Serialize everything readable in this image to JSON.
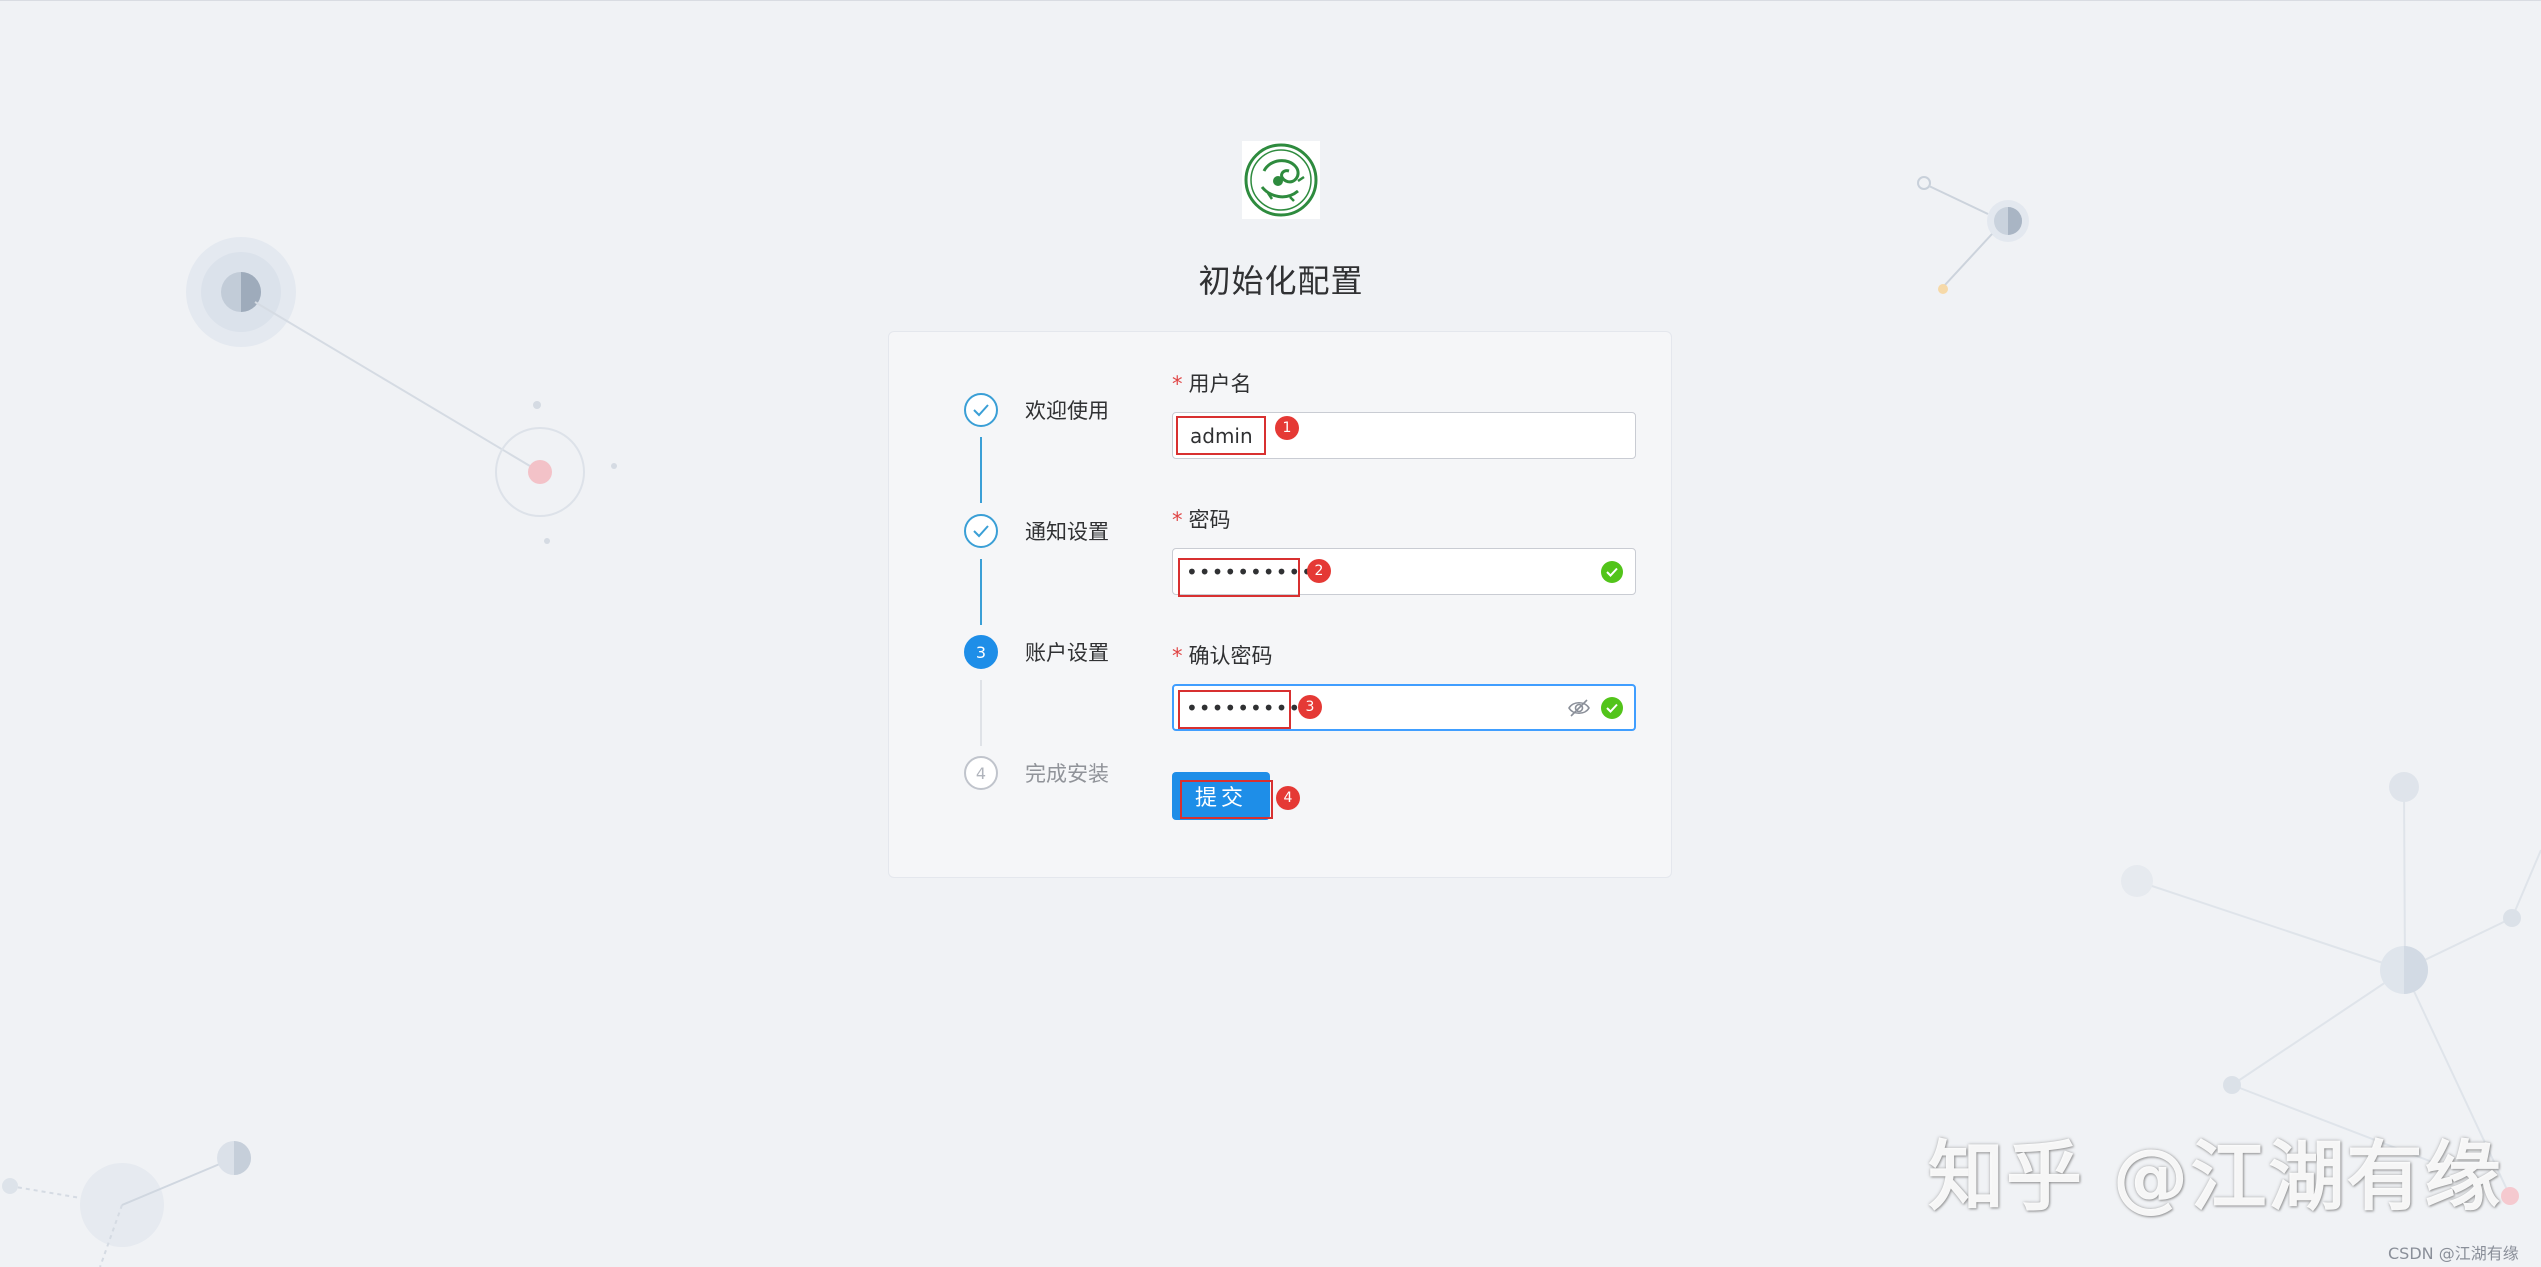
{
  "page": {
    "title": "初始化配置",
    "logo_icon": "green-dragon-emblem-icon"
  },
  "steps": [
    {
      "index": "1",
      "label": "欢迎使用",
      "status": "done"
    },
    {
      "index": "2",
      "label": "通知设置",
      "status": "done"
    },
    {
      "index": "3",
      "label": "账户设置",
      "status": "active"
    },
    {
      "index": "4",
      "label": "完成安装",
      "status": "wait"
    }
  ],
  "form": {
    "username": {
      "label": "用户名",
      "required_mark": "*",
      "value": "admin",
      "badge": "1"
    },
    "password": {
      "label": "密码",
      "required_mark": "*",
      "value": "••••••••••",
      "badge": "2"
    },
    "confirm_password": {
      "label": "确认密码",
      "required_mark": "*",
      "value": "••••••••••",
      "badge": "3"
    },
    "submit": {
      "label": "提交",
      "badge": "4"
    }
  },
  "watermark": {
    "text": "知乎 @江湖有缘",
    "credit": "CSDN @江湖有缘"
  },
  "colors": {
    "accent": "#1e8ee8",
    "step_done": "#3a9fd6",
    "required": "#e04545",
    "annotation": "#d83030",
    "valid": "#52c41a",
    "background": "#f0f2f5"
  }
}
